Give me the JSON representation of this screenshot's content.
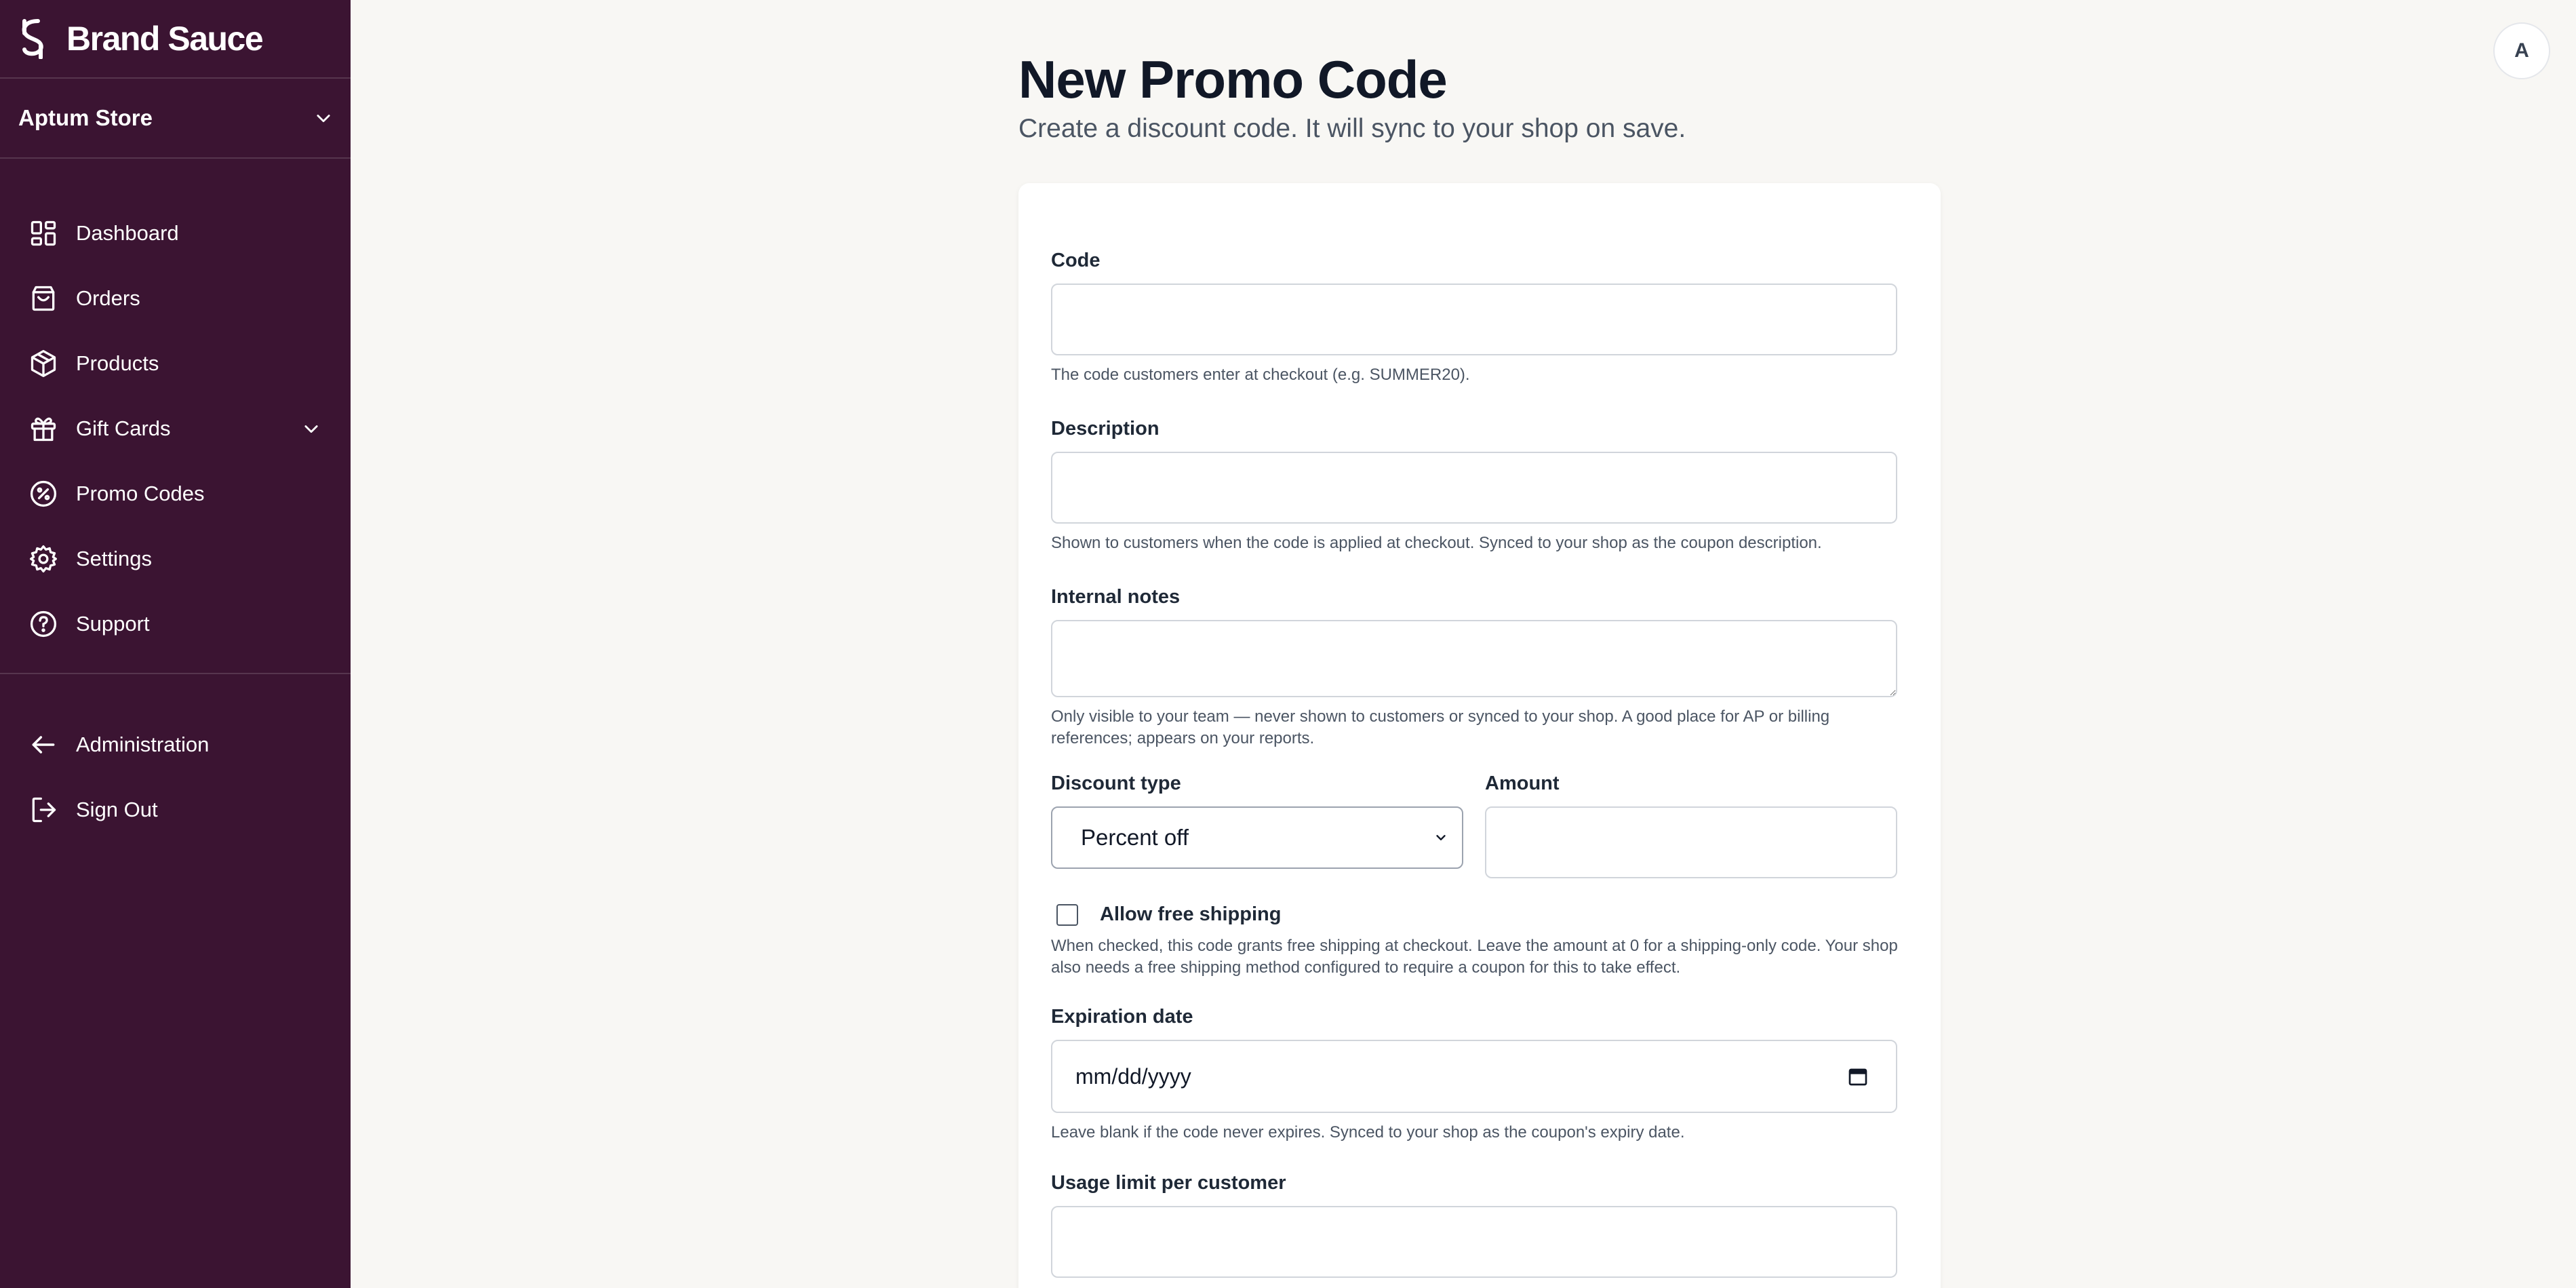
{
  "brand": {
    "name": "Brand Sauce"
  },
  "store": {
    "name": "Aptum Store"
  },
  "nav": {
    "items": [
      {
        "label": "Dashboard",
        "icon": "dashboard-icon"
      },
      {
        "label": "Orders",
        "icon": "shopping-bag-icon"
      },
      {
        "label": "Products",
        "icon": "box-icon"
      },
      {
        "label": "Gift Cards",
        "icon": "gift-icon",
        "expandable": true
      },
      {
        "label": "Promo Codes",
        "icon": "percent-badge-icon"
      },
      {
        "label": "Settings",
        "icon": "gear-icon"
      },
      {
        "label": "Support",
        "icon": "help-circle-icon"
      }
    ],
    "secondary": [
      {
        "label": "Administration",
        "icon": "arrow-left-icon"
      },
      {
        "label": "Sign Out",
        "icon": "sign-out-icon"
      }
    ]
  },
  "user": {
    "avatar_initial": "A"
  },
  "page": {
    "title": "New Promo Code",
    "subtitle": "Create a discount code. It will sync to your shop on save."
  },
  "form": {
    "code": {
      "label": "Code",
      "value": "",
      "help": "The code customers enter at checkout (e.g. SUMMER20)."
    },
    "description": {
      "label": "Description",
      "value": "",
      "help": "Shown to customers when the code is applied at checkout. Synced to your shop as the coupon description."
    },
    "internal_notes": {
      "label": "Internal notes",
      "value": "",
      "help": "Only visible to your team — never shown to customers or synced to your shop. A good place for AP or billing references; appears on your reports."
    },
    "discount_type": {
      "label": "Discount type",
      "value": "Percent off"
    },
    "amount": {
      "label": "Amount",
      "value": ""
    },
    "free_shipping": {
      "label": "Allow free shipping",
      "checked": false,
      "help": "When checked, this code grants free shipping at checkout. Leave the amount at 0 for a shipping-only code. Your shop also needs a free shipping method configured to require a coupon for this to take effect."
    },
    "expiration": {
      "label": "Expiration date",
      "placeholder": "mm/dd/yyyy",
      "help": "Leave blank if the code never expires. Synced to your shop as the coupon's expiry date."
    },
    "usage_limit": {
      "label": "Usage limit per customer",
      "value": ""
    }
  },
  "colors": {
    "sidebar_bg": "#3b1432",
    "page_bg": "#f8f7f4",
    "card_bg": "#ffffff"
  }
}
